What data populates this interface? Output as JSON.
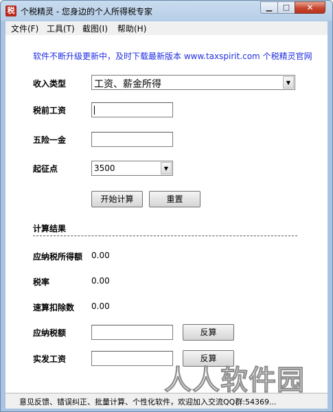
{
  "window": {
    "title": "个税精灵 - 您身边的个人所得税专家",
    "icon_char": "税",
    "min_glyph": "▁",
    "max_glyph": "□",
    "close_glyph": "✕"
  },
  "menu": {
    "items": [
      {
        "label": "文件(F)"
      },
      {
        "label": "工具(T)"
      },
      {
        "label": "截图(I)"
      },
      {
        "label": "帮助(H)"
      }
    ]
  },
  "notice": "软件不断升级更新中，及时下载最新版本 www.taxspirit.com 个税精灵官网",
  "form": {
    "income_type_label": "收入类型",
    "income_type_value": "工资、薪金所得",
    "pretax_label": "税前工资",
    "pretax_value": "",
    "insurance_label": "五险一金",
    "insurance_value": "",
    "threshold_label": "起征点",
    "threshold_value": "3500",
    "calc_button": "开始计算",
    "reset_button": "重置"
  },
  "results": {
    "section_title": "计算结果",
    "taxable_income_label": "应纳税所得额",
    "taxable_income_value": "0.00",
    "tax_rate_label": "税率",
    "tax_rate_value": "0.00",
    "quick_deduction_label": "速算扣除数",
    "quick_deduction_value": "0.00",
    "tax_payable_label": "应纳税额",
    "tax_payable_value": "",
    "net_salary_label": "实发工资",
    "net_salary_value": "",
    "reverse_button": "反算"
  },
  "status_bar": {
    "text": "意见反馈、错误纠正、批量计算、个性化软件，欢迎加入交流QQ群:54369..."
  },
  "watermark": "人人软件园",
  "colors": {
    "notice": "#1f2ee0",
    "close_button": "#c8462f",
    "window_frame": "#b7cfe8"
  }
}
